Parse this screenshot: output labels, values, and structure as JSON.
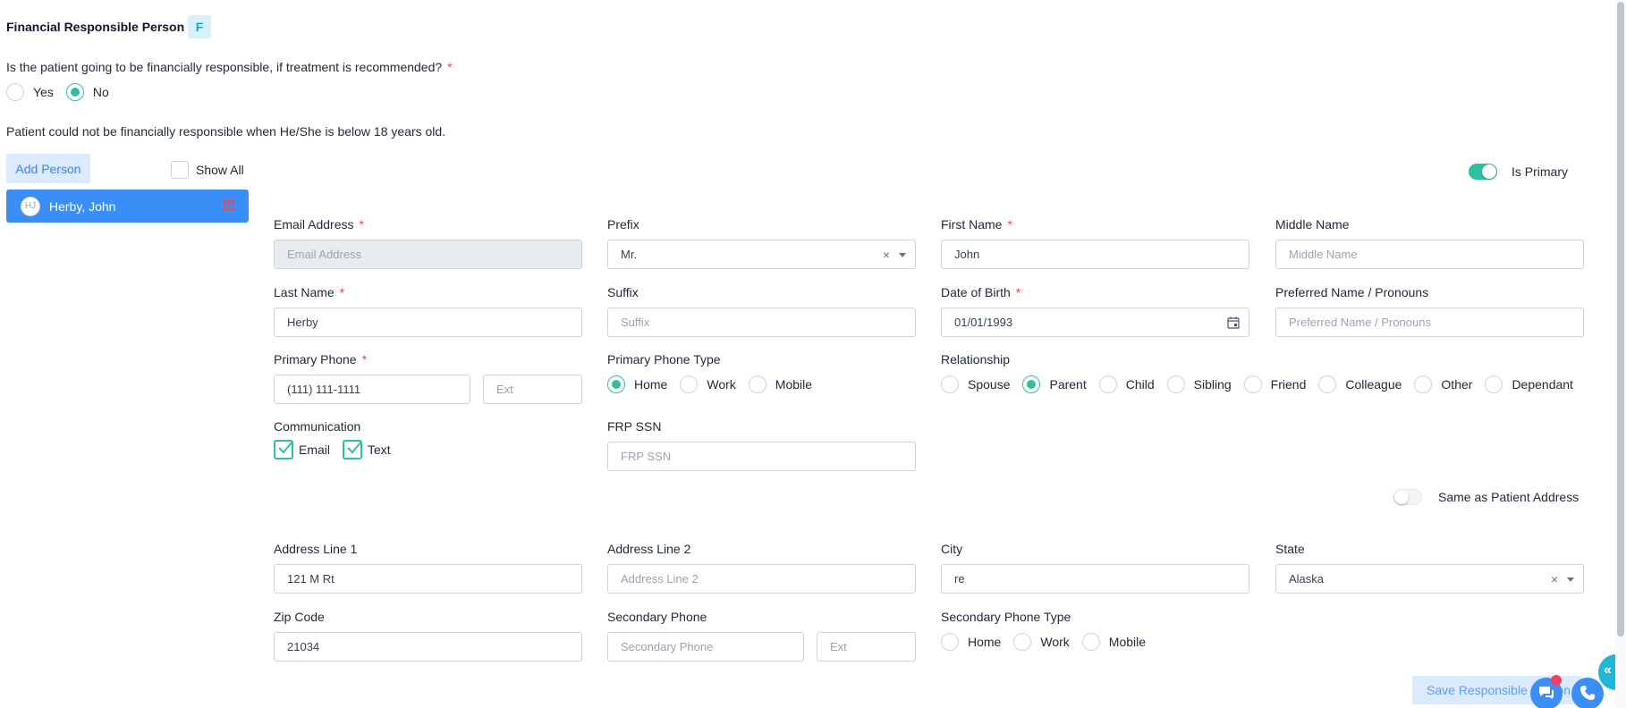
{
  "section": {
    "title": "Financial Responsible Person",
    "badge": "F"
  },
  "question": {
    "text": "Is the patient going to be financially responsible, if treatment is recommended?",
    "required": "*",
    "options": [
      "Yes",
      "No"
    ],
    "selected": "No"
  },
  "notice": "Patient could not be financially responsible when He/She is below 18 years old.",
  "sidebar": {
    "add_button": "Add Person",
    "show_all": "Show All",
    "persons": [
      {
        "initials": "HJ",
        "name": "Herby, John"
      }
    ]
  },
  "is_primary": {
    "label": "Is Primary",
    "value": true
  },
  "form": {
    "email": {
      "label": "Email Address",
      "placeholder": "Email Address",
      "required": "*"
    },
    "prefix": {
      "label": "Prefix",
      "value": "Mr."
    },
    "first_name": {
      "label": "First Name",
      "value": "John",
      "required": "*"
    },
    "middle_name": {
      "label": "Middle Name",
      "placeholder": "Middle Name"
    },
    "last_name": {
      "label": "Last Name",
      "value": "Herby",
      "required": "*"
    },
    "suffix": {
      "label": "Suffix",
      "placeholder": "Suffix"
    },
    "dob": {
      "label": "Date of Birth",
      "value": "01/01/1993",
      "required": "*"
    },
    "preferred": {
      "label": "Preferred Name / Pronouns",
      "placeholder": "Preferred Name / Pronouns"
    },
    "primary_phone": {
      "label": "Primary Phone",
      "value": "(111) 111-1111",
      "ext_placeholder": "Ext",
      "required": "*"
    },
    "primary_phone_type": {
      "label": "Primary Phone Type",
      "options": [
        "Home",
        "Work",
        "Mobile"
      ],
      "selected": "Home"
    },
    "relationship": {
      "label": "Relationship",
      "options": [
        "Spouse",
        "Parent",
        "Child",
        "Sibling",
        "Friend",
        "Colleague",
        "Other",
        "Dependant"
      ],
      "selected": "Parent"
    },
    "communication": {
      "label": "Communication",
      "options": [
        "Email",
        "Text"
      ]
    },
    "frp_ssn": {
      "label": "FRP SSN",
      "placeholder": "FRP SSN"
    },
    "same_as_patient": {
      "label": "Same as Patient Address",
      "value": false
    },
    "address1": {
      "label": "Address Line 1",
      "value": "121 M Rt"
    },
    "address2": {
      "label": "Address Line 2",
      "placeholder": "Address Line 2"
    },
    "city": {
      "label": "City",
      "value": "re"
    },
    "state": {
      "label": "State",
      "value": "Alaska"
    },
    "zip": {
      "label": "Zip Code",
      "value": "21034"
    },
    "secondary_phone": {
      "label": "Secondary Phone",
      "placeholder": "Secondary Phone",
      "ext_placeholder": "Ext"
    },
    "secondary_phone_type": {
      "label": "Secondary Phone Type",
      "options": [
        "Home",
        "Work",
        "Mobile"
      ]
    }
  },
  "save_button": "Save Responsible Person",
  "colors": {
    "accent": "#2cc0a0",
    "primary": "#3b8ef5",
    "required": "#ef4444"
  }
}
